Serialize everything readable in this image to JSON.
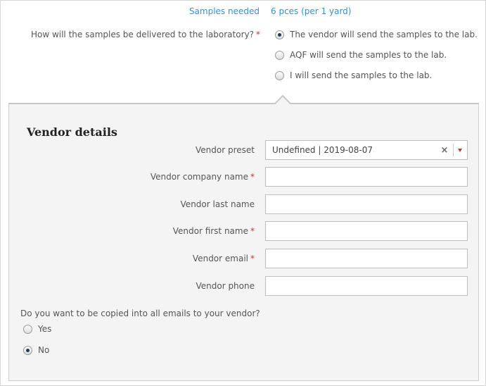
{
  "samples": {
    "label": "Samples needed",
    "value": "6 pces (per 1 yard)"
  },
  "delivery": {
    "question": "How will the samples be delivered to the laboratory?",
    "required_mark": "*",
    "options": [
      {
        "label": "The vendor will send the samples to the lab.",
        "checked": true
      },
      {
        "label": "AQF will send the samples to the lab.",
        "checked": false
      },
      {
        "label": "I will send the samples to the lab.",
        "checked": false
      }
    ]
  },
  "vendor_details": {
    "title": "Vendor details",
    "preset": {
      "label": "Vendor preset",
      "value": "Undefined | 2019-08-07",
      "clear_icon": "close-icon",
      "caret_icon": "caret-down-icon"
    },
    "fields": [
      {
        "label": "Vendor company name",
        "required": true,
        "value": ""
      },
      {
        "label": "Vendor last name",
        "required": false,
        "value": ""
      },
      {
        "label": "Vendor first name",
        "required": true,
        "value": ""
      },
      {
        "label": "Vendor email",
        "required": true,
        "value": ""
      },
      {
        "label": "Vendor phone",
        "required": false,
        "value": ""
      }
    ]
  },
  "copy_emails": {
    "question": "Do you want to be copied into all emails to your vendor?",
    "options": [
      {
        "label": "Yes",
        "checked": false
      },
      {
        "label": "No",
        "checked": true
      }
    ]
  },
  "colors": {
    "link_blue": "#3a8fd0",
    "required_red": "#d0302f",
    "panel_bg": "#f4f4f4"
  }
}
